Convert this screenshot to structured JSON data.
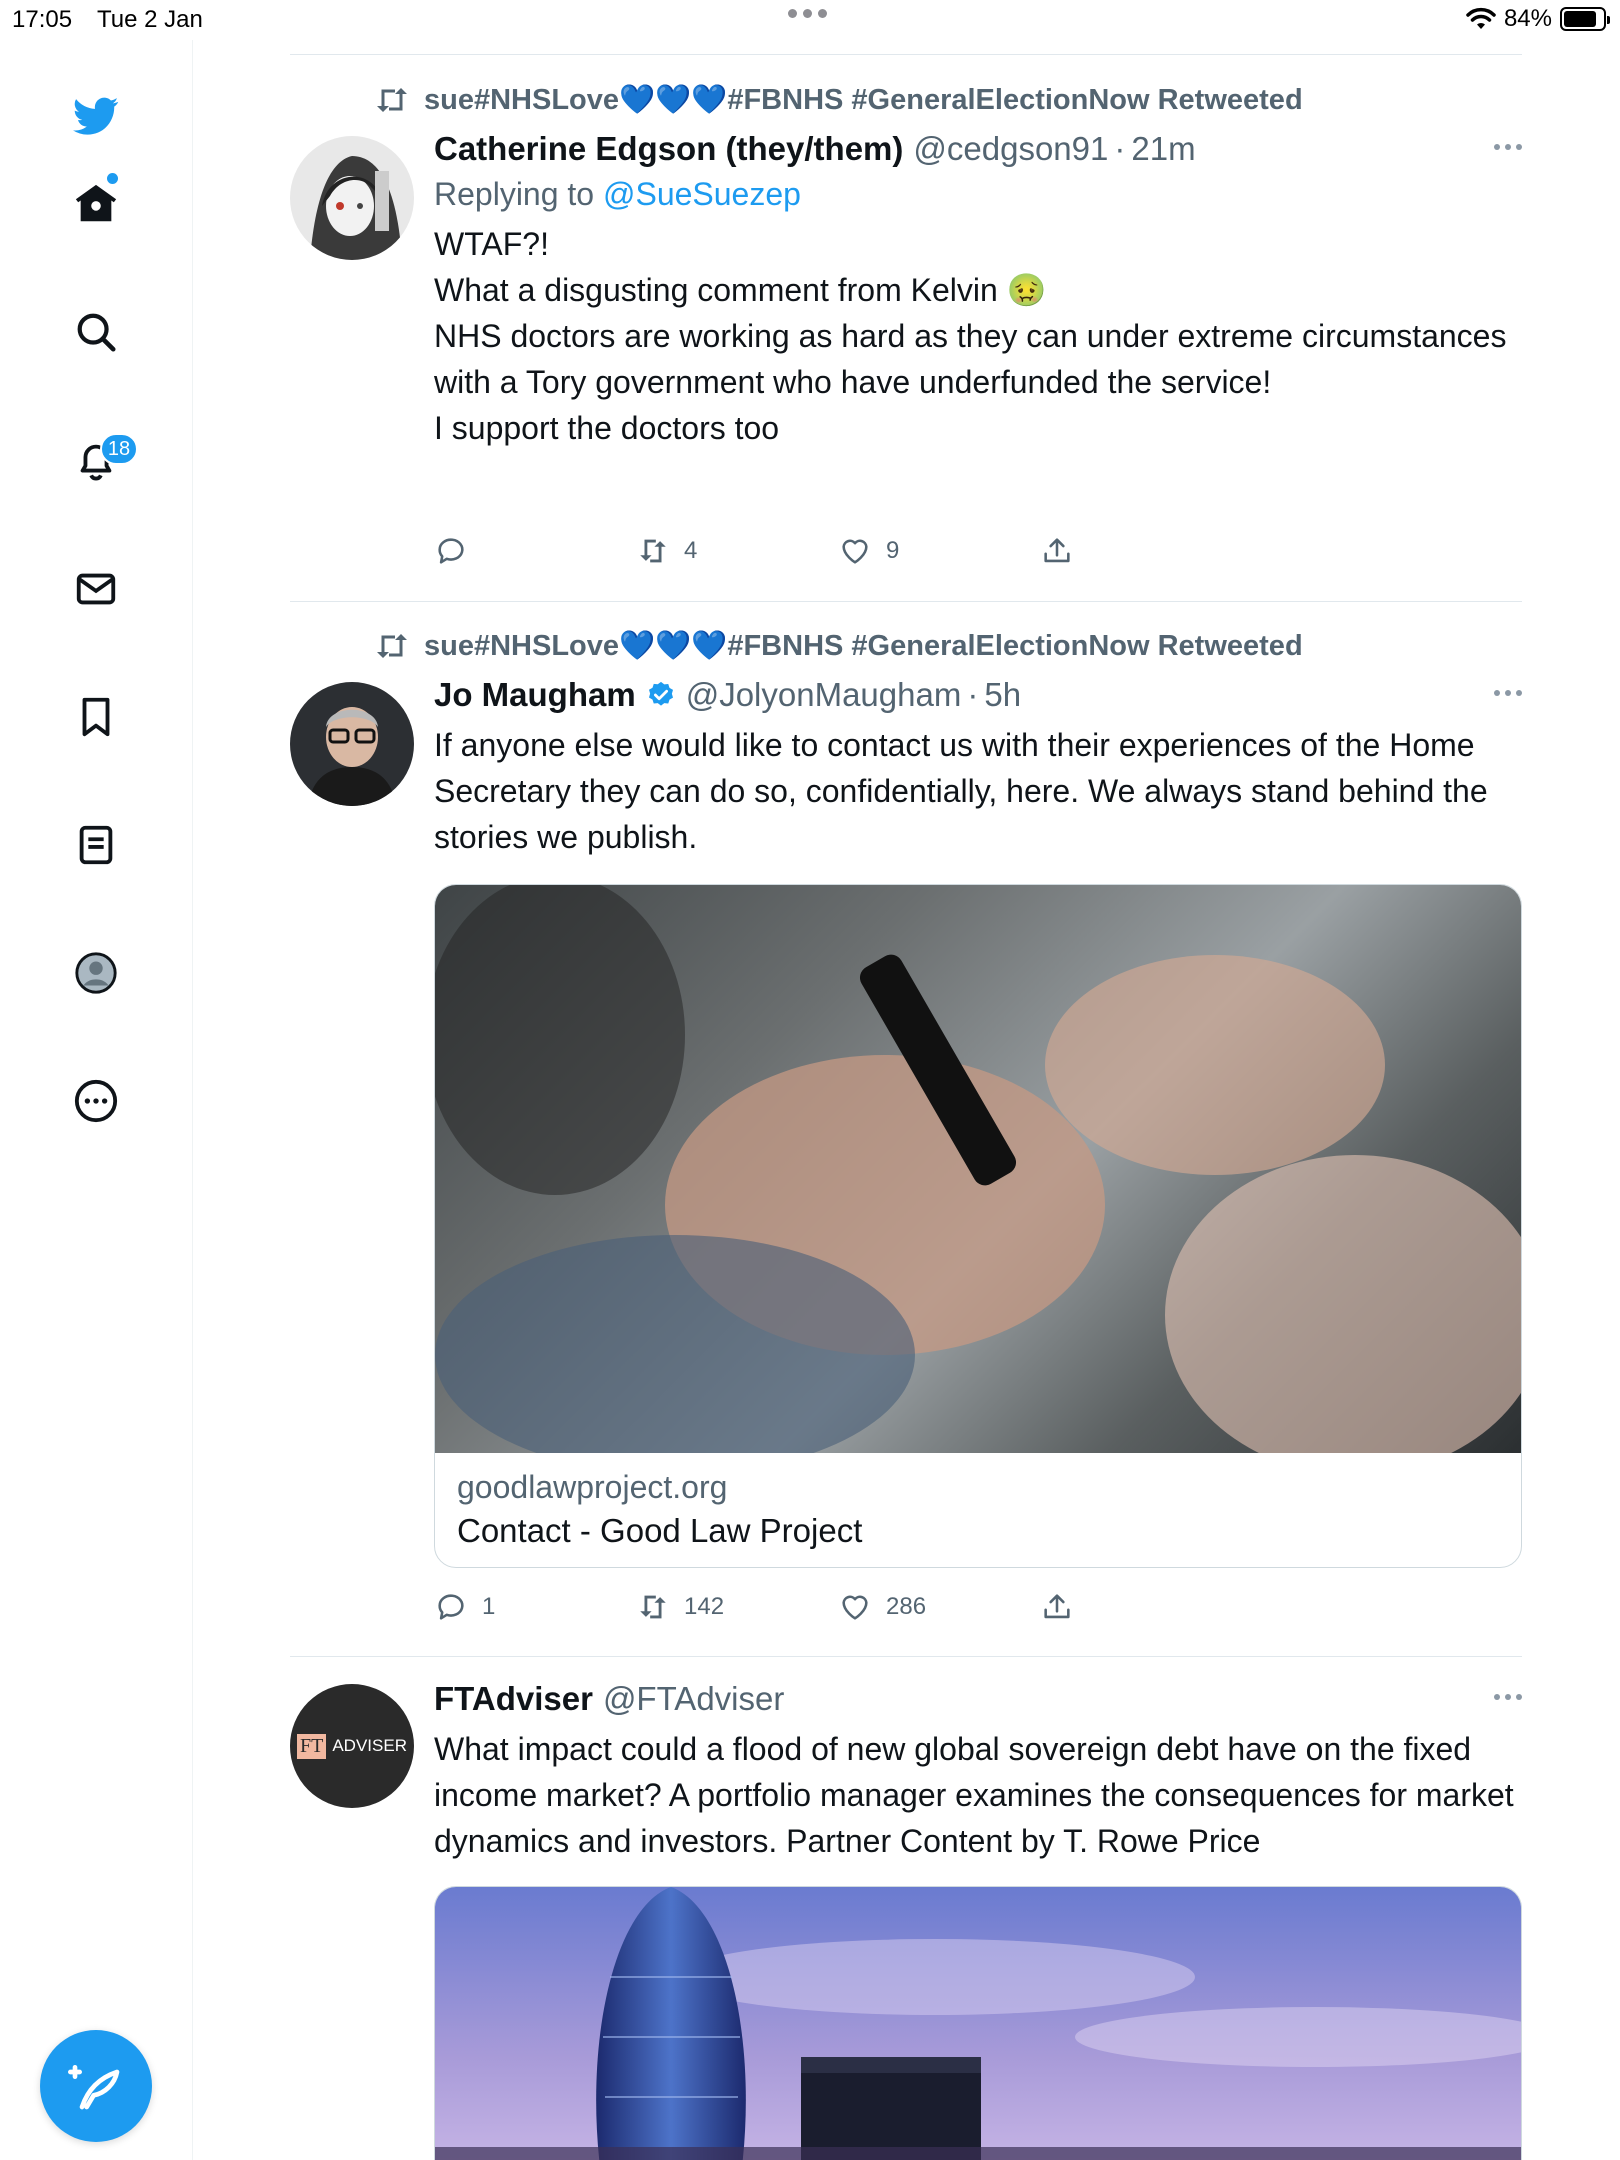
{
  "status_bar": {
    "time": "17:05",
    "date": "Tue 2 Jan",
    "battery": "84%",
    "battery_level": 0.84
  },
  "sidebar": {
    "items": [
      {
        "name": "twitter-logo-icon"
      },
      {
        "name": "home-icon"
      },
      {
        "name": "search-icon"
      },
      {
        "name": "notifications-icon",
        "badge": "18"
      },
      {
        "name": "messages-icon"
      },
      {
        "name": "bookmarks-icon"
      },
      {
        "name": "lists-icon"
      },
      {
        "name": "profile-icon"
      },
      {
        "name": "more-icon"
      }
    ],
    "compose_icon": "compose-tweet-icon"
  },
  "colors": {
    "accent": "#1d9bf0",
    "text": "#0f1419",
    "secondary": "#536471",
    "divider": "#e1e8ed"
  },
  "tweets": [
    {
      "retweet_label": "sue#NHSLove💙💙💙#FBNHS #GeneralElectionNow Retweeted",
      "name": "Catherine Edgson (they/them)",
      "handle": "@cedgson91",
      "time": "21m",
      "reply_prefix": "Replying to",
      "reply_to": "@SueSuezep",
      "text": "WTAF?!\nWhat a disgusting comment from Kelvin 🤢\nNHS doctors  are working as hard as they can under extreme circumstances with a Tory government who have underfunded the service!\nI support the doctors too",
      "replies": "",
      "retweets": "4",
      "likes": "9"
    },
    {
      "retweet_label": "sue#NHSLove💙💙💙#FBNHS #GeneralElectionNow Retweeted",
      "name": "Jo Maugham",
      "handle": "@JolyonMaugham",
      "time": "5h",
      "text": "If anyone else would like to contact us with their experiences of the Home Secretary they can do so, confidentially, here. We always stand behind the stories we publish.",
      "card_domain": "goodlawproject.org",
      "card_title": "Contact - Good Law Project",
      "replies": "1",
      "retweets": "142",
      "likes": "286"
    },
    {
      "name": "FTAdviser",
      "handle": "@FTAdviser",
      "avatar_logo": "FT",
      "avatar_text": "ADVISER",
      "text": "What impact could a flood of new global sovereign debt have on the fixed income market? A portfolio manager examines the consequences for market dynamics and investors. Partner Content by T. Rowe Price"
    }
  ]
}
